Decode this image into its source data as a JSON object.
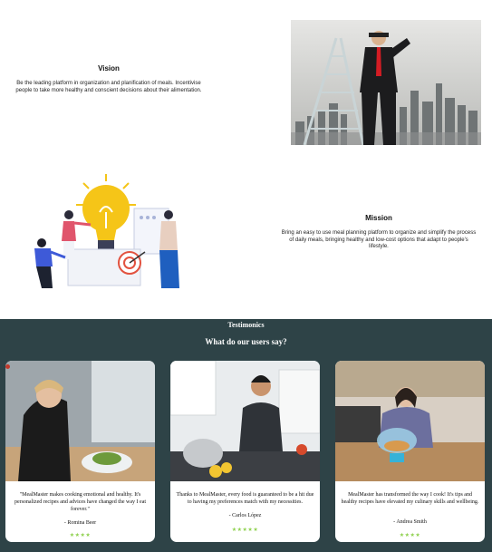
{
  "vision": {
    "title": "Vision",
    "text": "Be the leading platform in organization and planification of meals. Incentivise people to take more healthy and conscient decisions about their alimentation."
  },
  "mission": {
    "title": "Mission",
    "text": "Bring an easy to use meal planning platform to organize and simplify the process of daily meals, bringing healthy and low-cost options that adapt to people's lifestyle."
  },
  "testimonials": {
    "eyebrow": "Testimonics",
    "title": "What do our users say?",
    "cards": [
      {
        "quote": "\"MealMaster makes cooking emotional and healthy. It's personalized recipes and advices have changed the way I eat forever.\"",
        "author": "- Romina Beer",
        "stars": "★★★★"
      },
      {
        "quote": "Thanks to MealMaster, every food is guaranteed to be a hit due to having my preferences match with my necessities.",
        "author": "- Carlos López",
        "stars": "★★★★★"
      },
      {
        "quote": "MealMaster has transformed the way I cook! It's tips and healthy recipes have elevated my culinary skills and wellbeing.",
        "author": "- Andrea Smith",
        "stars": "★★★★"
      }
    ]
  },
  "colors": {
    "dark_section": "#2e4347",
    "star": "#8fd14f",
    "bulb": "#f5c518"
  }
}
